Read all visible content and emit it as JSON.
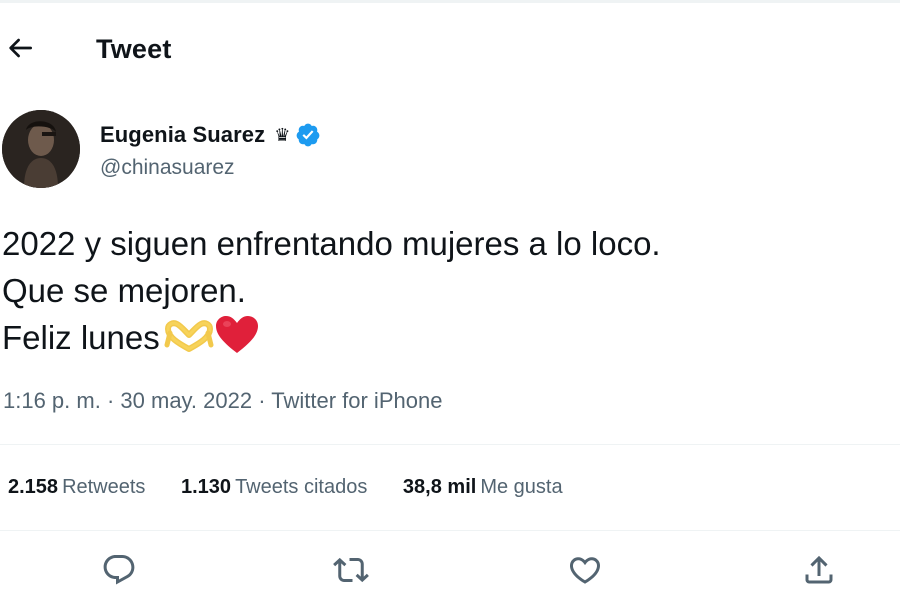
{
  "header": {
    "back_icon": "arrow-left-icon",
    "title": "Tweet"
  },
  "author": {
    "display_name": "Eugenia Suarez",
    "crown_glyph": "♛",
    "handle": "@chinasuarez",
    "verified_color": "#1d9bf0"
  },
  "tweet": {
    "lines": [
      "2022 y siguen enfrentando mujeres a lo loco.",
      "Que se mejoren.",
      "Feliz lunes"
    ],
    "emoji_icons": [
      "heart-hands-emoji-icon",
      "red-heart-emoji-icon"
    ]
  },
  "meta": {
    "time": "1:16 p. m.",
    "separator": " · ",
    "date": "30 may. 2022",
    "source": "Twitter for iPhone"
  },
  "stats": [
    {
      "count": "2.158",
      "label": "Retweets"
    },
    {
      "count": "1.130",
      "label": "Tweets citados"
    },
    {
      "count": "38,8 mil",
      "label": "Me gusta"
    }
  ],
  "actions": [
    {
      "icon": "reply-icon"
    },
    {
      "icon": "retweet-icon"
    },
    {
      "icon": "like-icon"
    },
    {
      "icon": "share-icon"
    }
  ],
  "colors": {
    "text_primary": "#0f1419",
    "text_secondary": "#536471",
    "divider": "#eff3f4",
    "heart_red": "#e0203a",
    "hands_yellow": "#f7d35a"
  }
}
